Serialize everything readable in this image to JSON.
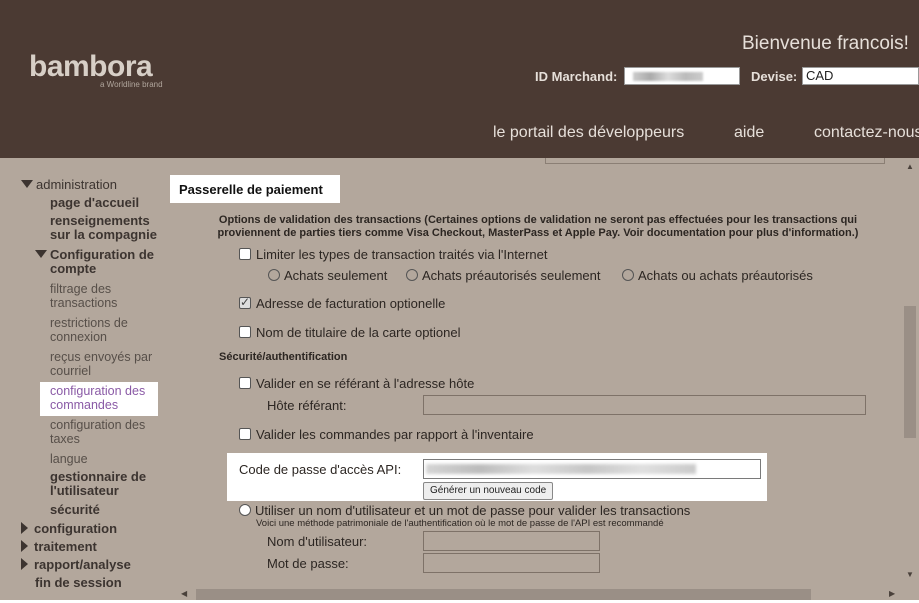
{
  "header": {
    "logo": "bambora",
    "logo_sub": "a Worldline brand",
    "welcome": "Bienvenue francois!",
    "merchant_label": "ID Marchand:",
    "currency_label": "Devise:",
    "currency_value": "CAD",
    "nav": [
      "le portail des développeurs",
      "aide",
      "contactez-nous"
    ]
  },
  "sidebar": {
    "administration": "administration",
    "home": "page d'accueil",
    "company_info_1": "renseignements",
    "company_info_2": "sur la compagnie",
    "account_config_1": "Configuration de",
    "account_config_2": "compte",
    "tx_filter_1": "filtrage des",
    "tx_filter_2": "transactions",
    "login_restr_1": "restrictions de",
    "login_restr_2": "connexion",
    "receipts_1": "reçus envoyés par",
    "receipts_2": "courriel",
    "order_config_1": "configuration des",
    "order_config_2": "commandes",
    "tax_config_1": "configuration des",
    "tax_config_2": "taxes",
    "language": "langue",
    "user_mgr_1": "gestionnaire de",
    "user_mgr_2": "l'utilisateur",
    "security": "sécurité",
    "configuration": "configuration",
    "processing": "traitement",
    "reporting": "rapport/analyse",
    "logout": "fin de session"
  },
  "content": {
    "section_title": "Passerelle de paiement",
    "validation_note_1": "Options de validation des transactions  (Certaines options de validation ne seront pas effectuées pour les transactions qui",
    "validation_note_2": "proviennent de parties tiers comme Visa Checkout, MasterPass et Apple Pay. Voir documentation pour plus d'information.)",
    "limit_types": "Limiter les types de transaction traités via l'Internet",
    "radio_purchases": "Achats seulement",
    "radio_preauth": "Achats préautorisés seulement",
    "radio_both": "Achats ou achats préautorisés",
    "billing_optional": "Adresse de facturation optionelle",
    "billing_optional_checked": true,
    "cardholder_optional": "Nom de titulaire de la carte optionel",
    "security_heading": "Sécurité/authentification",
    "validate_host": "Valider en se référant à l'adresse hôte",
    "host_label": "Hôte référant:",
    "validate_inventory": "Valider les commandes par rapport à l'inventaire",
    "api_label": "Code de passe d'accès API:",
    "generate_button": "Générer un nouveau code",
    "use_credentials": "Utiliser un nom d'utilisateur et un mot de passe pour valider les transactions",
    "credentials_note": "Voici une méthode patrimoniale de l'authentification où le mot de passe de l'API est recommandé",
    "username_label": "Nom d'utilisateur:",
    "password_label": "Mot de passe:"
  },
  "colors": {
    "header_bg": "#4b3a33",
    "content_bg": "#b3a79c",
    "active_link": "#8a5aa6"
  }
}
